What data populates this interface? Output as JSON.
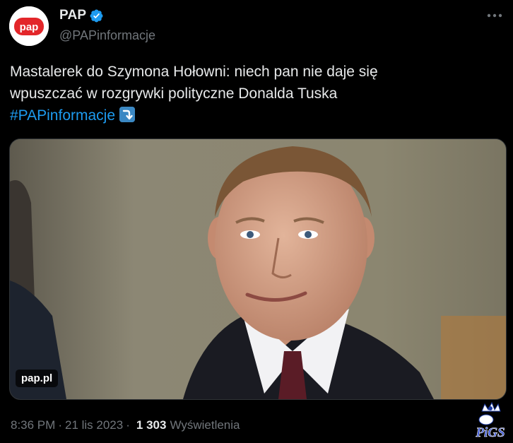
{
  "author": {
    "display_name": "PAP",
    "handle": "@PAPinformacje",
    "avatar_logo_text": "pap",
    "verified_icon": "verified-badge-icon"
  },
  "more_icon": "more-horizontal-icon",
  "tweet": {
    "line1": "Mastalerek do Szymona Hołowni: niech pan nie daje się",
    "line2": "wpuszczać w rozgrywki polityczne Donalda Tuska",
    "hashtag": "#PAPinformacje",
    "emoji": "right-arrow-curving-down-icon"
  },
  "media": {
    "source_label": "pap.pl"
  },
  "meta": {
    "time": "8:36 PM",
    "separator": "·",
    "date": "21 lis 2023",
    "separator2": "·",
    "views_count": "1 303",
    "views_label": "Wyświetlenia"
  },
  "watermark_text": "PiGS",
  "colors": {
    "background": "#000000",
    "text": "#e7e9ea",
    "secondary": "#71767b",
    "link": "#1d9bf0",
    "verified": "#1d9bf0",
    "brand_red": "#e3262a"
  }
}
